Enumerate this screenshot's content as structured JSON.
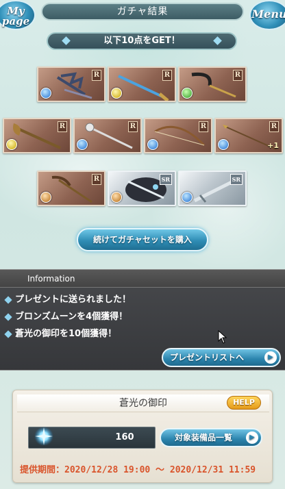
{
  "header": {
    "title": "ガチャ結果",
    "mypage_label_line1": "My",
    "mypage_label_line2": "page",
    "menu_label": "Menu"
  },
  "banner": {
    "text": "以下10点をGET！"
  },
  "items": [
    {
      "rarity": "R",
      "element": "water",
      "icon": "bat-wing-blade-icon"
    },
    {
      "rarity": "R",
      "element": "light",
      "icon": "katana-icon"
    },
    {
      "rarity": "R",
      "element": "wind",
      "icon": "scythe-bow-icon"
    },
    {
      "rarity": "R",
      "element": "light",
      "icon": "axe-icon"
    },
    {
      "rarity": "R",
      "element": "water",
      "icon": "staff-icon"
    },
    {
      "rarity": "R",
      "element": "water",
      "icon": "bow-icon"
    },
    {
      "rarity": "R",
      "element": "water",
      "icon": "spear-icon",
      "badge": "+1"
    },
    {
      "rarity": "R",
      "element": "earth",
      "icon": "pickaxe-icon"
    },
    {
      "rarity": "SR",
      "element": "earth",
      "icon": "dark-armor-summon-icon"
    },
    {
      "rarity": "SR",
      "element": "water",
      "icon": "silver-sword-icon"
    }
  ],
  "continue_button": {
    "label": "続けてガチャセットを購入"
  },
  "information": {
    "title": "Information",
    "lines": [
      "プレゼントに送られました！",
      "ブロンズムーンを4個獲得！",
      "蒼光の御印を10個獲得！"
    ],
    "present_list_label": "プレゼントリストへ"
  },
  "seal": {
    "title": "蒼光の御印",
    "help_label": "HELP",
    "count": "160",
    "equip_list_label": "対象装備品一覧",
    "period": "提供期間：2020/12/28 19:00 ～ 2020/12/31 11:59"
  },
  "colors": {
    "accent_blue": "#2f8db5",
    "period_red": "#d9542b",
    "help_orange": "#e59b1b"
  }
}
